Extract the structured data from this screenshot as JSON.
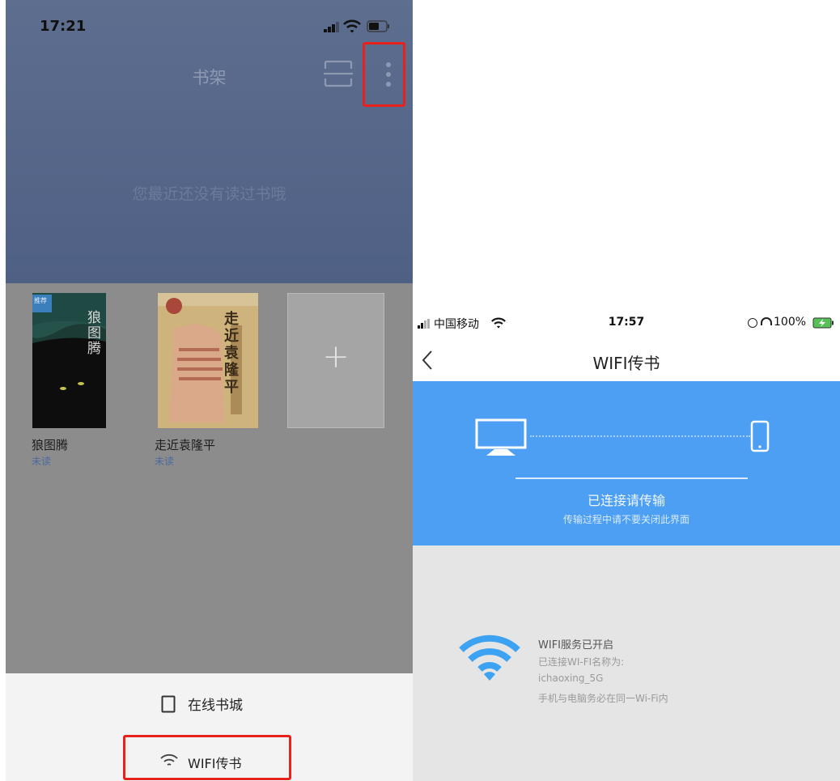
{
  "left_screen": {
    "status_time": "17:21",
    "title": "书架",
    "empty_message": "您最近还没有读过书哦",
    "books": [
      {
        "title": "狼图腾",
        "status": "未读",
        "cover_text": "狼图腾",
        "badge": "推荐"
      },
      {
        "title": "走近袁隆平",
        "status": "未读",
        "cover_text": "走近袁隆平"
      }
    ],
    "add_button": "+",
    "menu": {
      "online_store": "在线书城",
      "wifi_transfer": "WIFI传书"
    }
  },
  "right_screen": {
    "status": {
      "carrier": "中国移动",
      "time": "17:57",
      "battery": "100%"
    },
    "nav_title": "WIFI传书",
    "banner": {
      "main_text": "已连接请传输",
      "sub_text": "传输过程中请不要关闭此界面"
    },
    "info": {
      "line1": "WIFI服务已开启",
      "line2": "已连接WI-FI名称为:",
      "line3": "ichaoxing_5G",
      "line4": "手机与电脑务必在同一Wi-Fi内"
    }
  },
  "colors": {
    "header_blue": "#5d6e8f",
    "banner_blue": "#4c9ff2",
    "wifi_blue": "#3ea2f2",
    "highlight_red": "#e8221a"
  }
}
